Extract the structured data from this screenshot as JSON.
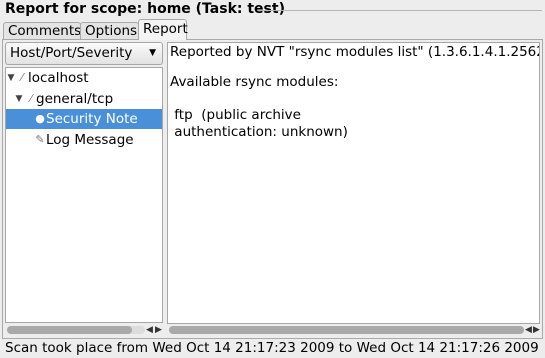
{
  "window": {
    "title": "Report for scope: home (Task: test)"
  },
  "tabs": [
    {
      "label": "Comments"
    },
    {
      "label": "Options"
    },
    {
      "label": "Report",
      "active": true
    }
  ],
  "view_selector": {
    "selected": "Host/Port/Severity"
  },
  "tree": {
    "nodes": [
      {
        "label": "localhost",
        "expanded": true,
        "icon": "host-icon"
      },
      {
        "label": "general/tcp",
        "expanded": true,
        "icon": "port-icon"
      },
      {
        "label": "Security Note",
        "selected": true,
        "icon": "note-icon"
      },
      {
        "label": "Log Message",
        "icon": "log-icon"
      }
    ]
  },
  "report": {
    "lines": [
      "Reported by NVT \"rsync modules list\" (1.3.6.1.4.1.25623.1.",
      "",
      "Available rsync modules:",
      "",
      " ftp  (public archive",
      " authentication: unknown)"
    ]
  },
  "status": {
    "text": "Scan took place from Wed Oct 14 21:17:23 2009 to Wed Oct 14 21:17:26 2009"
  },
  "colors": {
    "selection": "#4a90d9",
    "background": "#ededed"
  }
}
